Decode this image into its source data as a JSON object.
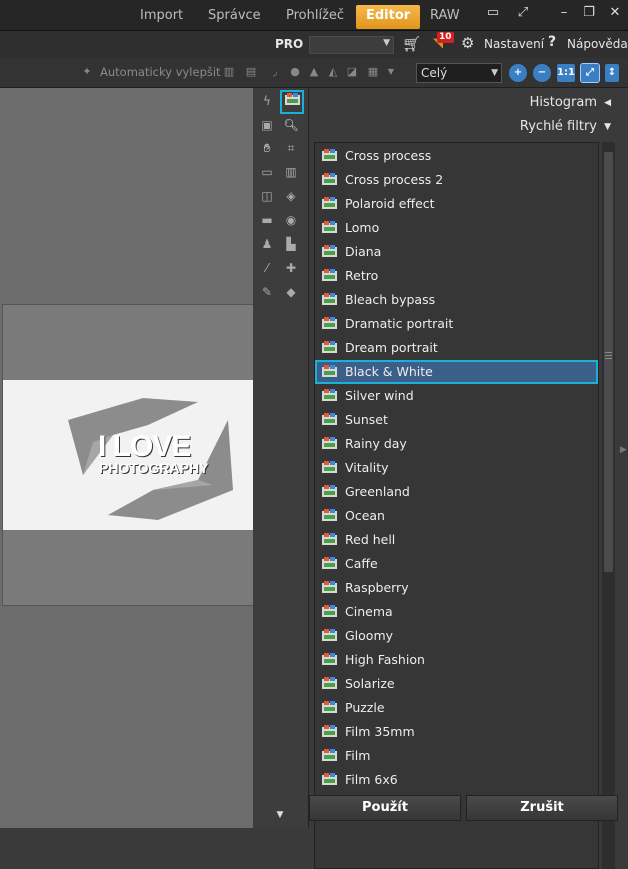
{
  "tabs": [
    {
      "label": "Import"
    },
    {
      "label": "Správce"
    },
    {
      "label": "Prohlížeč"
    },
    {
      "label": "Editor"
    },
    {
      "label": "RAW"
    }
  ],
  "menubar": {
    "pro_label": "PRO",
    "notification_count": "10",
    "settings_label": "Nastavení",
    "help_label": "Nápověda"
  },
  "toolbar": {
    "auto_enhance_label": "Automaticky vylepšit",
    "zoom_select": "Celý",
    "actual_size_label": "1:1"
  },
  "panel": {
    "histogram_label": "Histogram",
    "quick_filters_label": "Rychlé filtry",
    "apply_label": "Použít",
    "cancel_label": "Zrušit"
  },
  "photo": {
    "line1": "I LOVE",
    "line2": "PHOTOGRAPHY"
  },
  "filters": [
    "Cross process",
    "Cross process 2",
    "Polaroid effect",
    "Lomo",
    "Diana",
    "Retro",
    "Bleach bypass",
    "Dramatic portrait",
    "Dream portrait",
    "Black & White",
    "Silver wind",
    "Sunset",
    "Rainy day",
    "Vitality",
    "Greenland",
    "Ocean",
    "Red hell",
    "Caffe",
    "Raspberry",
    "Cinema",
    "Gloomy",
    "High Fashion",
    "Solarize",
    "Puzzle",
    "Film 35mm",
    "Film",
    "Film 6x6"
  ],
  "selected_filter": "Black & White",
  "colors": {
    "accent": "#f0a830",
    "selection": "#3c5f8a",
    "highlight": "#1bb0d8"
  }
}
